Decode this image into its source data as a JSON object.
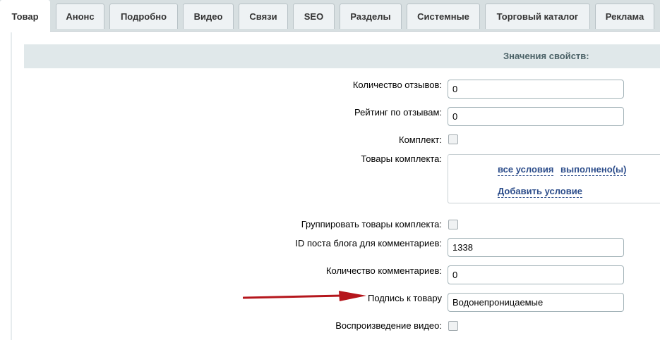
{
  "tabs": [
    {
      "label": "Товар",
      "active": true
    },
    {
      "label": "Анонс"
    },
    {
      "label": "Подробно"
    },
    {
      "label": "Видео"
    },
    {
      "label": "Связи"
    },
    {
      "label": "SEO"
    },
    {
      "label": "Разделы"
    },
    {
      "label": "Системные"
    },
    {
      "label": "Торговый каталог"
    },
    {
      "label": "Реклама"
    }
  ],
  "section": {
    "title": "Значения свойств:"
  },
  "fields": {
    "reviews_count": {
      "label": "Количество отзывов:",
      "value": "0"
    },
    "reviews_rating": {
      "label": "Рейтинг по отзывам:",
      "value": "0"
    },
    "set": {
      "label": "Комплект:"
    },
    "set_products": {
      "label": "Товары комплекта:",
      "link_all": "все условия",
      "link_done": "выполнено(ы)",
      "link_add": "Добавить условие"
    },
    "group_set": {
      "label": "Группировать товары комплекта:"
    },
    "blog_post_id": {
      "label": "ID поста блога для комментариев:",
      "value": "1338"
    },
    "comments_count": {
      "label": "Количество комментариев:",
      "value": "0"
    },
    "product_caption": {
      "label": "Подпись к товару",
      "value": "Водонепроницаемые"
    },
    "video_autoplay": {
      "label": "Воспроизведение видео:"
    }
  },
  "colors": {
    "arrow": "#b5161c",
    "link": "#2b4c8a",
    "header_bg": "#e0e8ea"
  },
  "icons": {
    "arrow": "red-arrow-icon"
  }
}
